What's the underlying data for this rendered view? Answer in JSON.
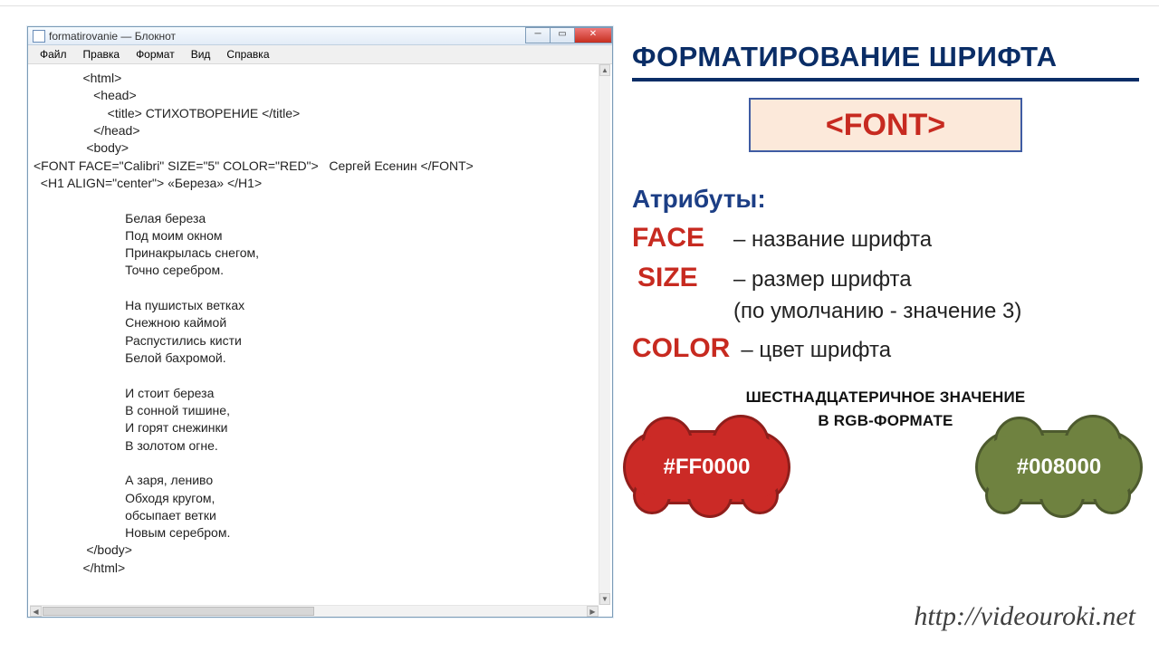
{
  "window": {
    "title": "formatirovanie — Блокнот",
    "menu": [
      "Файл",
      "Правка",
      "Формат",
      "Вид",
      "Справка"
    ]
  },
  "code": {
    "l1": "              <html>",
    "l2": "                 <head>",
    "l3": "                     <title> СТИХОТВОРЕНИЕ </title>",
    "l4": "                 </head>",
    "l5": "               <body>",
    "l6": "<FONT FACE=\"Calibri\" SIZE=\"5\" COLOR=\"RED\">   Сергей Есенин </FONT>",
    "l7": "  <H1 ALIGN=\"center\"> «Береза» </H1>",
    "l8": "",
    "l9": "                          Белая береза",
    "l10": "                          Под моим окном",
    "l11": "                          Принакрылась снегом,",
    "l12": "                          Точно серебром.",
    "l13": "",
    "l14": "                          На пушистых ветках",
    "l15": "                          Снежною каймой",
    "l16": "                          Распустились кисти",
    "l17": "                          Белой бахромой.",
    "l18": "",
    "l19": "                          И стоит береза",
    "l20": "                          В сонной тишине,",
    "l21": "                          И горят снежинки",
    "l22": "                          В золотом огне.",
    "l23": "",
    "l24": "                          А заря, лениво",
    "l25": "                          Обходя кругом,",
    "l26": "                          обсыпает ветки",
    "l27": "                          Новым серебром.",
    "l28": "               </body>",
    "l29": "              </html>"
  },
  "lesson": {
    "heading": "ФОРМАТИРОВАНИЕ ШРИФТА",
    "tag_label": "<FONT>",
    "attr_title": "Атрибуты:",
    "face_kw": "FACE",
    "face_desc": "– название шрифта",
    "size_kw": "SIZE",
    "size_desc": "– размер шрифта",
    "size_note": "(по умолчанию - значение 3)",
    "color_kw": "COLOR",
    "color_desc": "– цвет шрифта",
    "hex_line1": "ШЕСТНАДЦАТЕРИЧНОЕ  ЗНАЧЕНИЕ",
    "hex_line2": "В RGB-ФОРМАТЕ",
    "red_hex": "#FF0000",
    "green_hex": "#008000",
    "url": "http://videouroki.net"
  }
}
